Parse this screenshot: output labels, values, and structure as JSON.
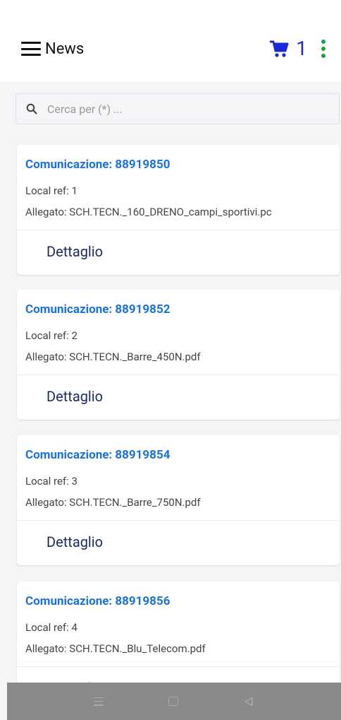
{
  "header": {
    "title": "News",
    "cart_count": "1"
  },
  "search": {
    "placeholder": "Cerca per (*) ..."
  },
  "cards": [
    {
      "title": "Comunicazione: 88919850",
      "local_ref": "Local ref: 1",
      "attachment": "Allegato: SCH.TECN._160_DRENO_campi_sportivi.pc",
      "button": "Dettaglio"
    },
    {
      "title": "Comunicazione: 88919852",
      "local_ref": "Local ref: 2",
      "attachment": "Allegato: SCH.TECN._Barre_450N.pdf",
      "button": "Dettaglio"
    },
    {
      "title": "Comunicazione: 88919854",
      "local_ref": "Local ref: 3",
      "attachment": "Allegato: SCH.TECN._Barre_750N.pdf",
      "button": "Dettaglio"
    },
    {
      "title": "Comunicazione: 88919856",
      "local_ref": "Local ref: 4",
      "attachment": "Allegato: SCH.TECN._Blu_Telecom.pdf",
      "button": "Dettaglio"
    }
  ],
  "colors": {
    "accent_blue": "#1a73d9",
    "cart_blue": "#1a2bd6",
    "kebab_green": "#1aa33a",
    "button_text": "#1f2a60"
  },
  "icons": {
    "menu": "menu-icon",
    "cart": "cart-icon",
    "more": "kebab-icon",
    "search": "search-icon"
  }
}
